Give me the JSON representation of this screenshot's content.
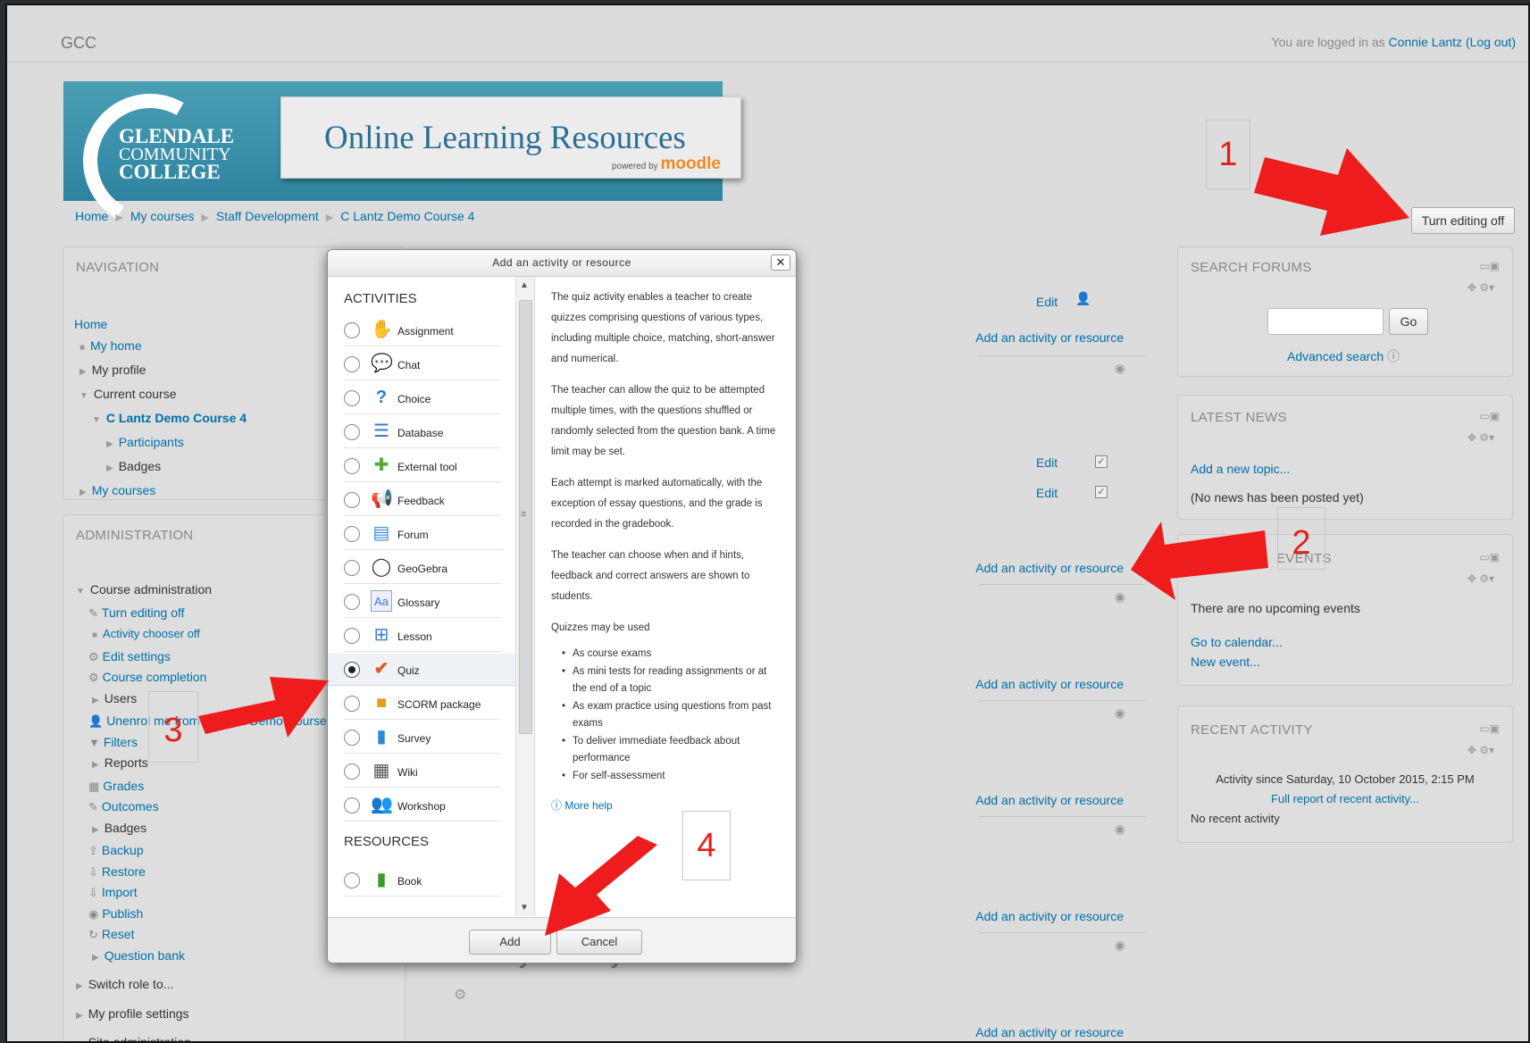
{
  "site_name": "GCC",
  "login": {
    "prefix": "You are logged in as ",
    "user": "Connie Lantz",
    "logout": "(Log out)"
  },
  "banner": {
    "college_line1": "GLENDALE",
    "college_line2": "COMMUNITY",
    "college_line3": "COLLEGE",
    "title": "Online Learning Resources",
    "powered_by": "powered by",
    "moodle": "moodle"
  },
  "breadcrumb": [
    "Home",
    "My courses",
    "Staff Development",
    "C Lantz Demo Course 4"
  ],
  "turn_editing_button": "Turn editing off",
  "navigation": {
    "title": "NAVIGATION",
    "items": [
      "Home",
      "My home",
      "My profile",
      "Current course",
      "C Lantz Demo Course 4",
      "Participants",
      "Badges",
      "My courses"
    ]
  },
  "administration": {
    "title": "ADMINISTRATION",
    "items": [
      "Course administration",
      "Turn editing off",
      "Activity chooser off",
      "Edit settings",
      "Course completion",
      "Users",
      "Unenrol me from C Lantz Demo Course 4",
      "Filters",
      "Reports",
      "Grades",
      "Outcomes",
      "Badges",
      "Backup",
      "Restore",
      "Import",
      "Publish",
      "Reset",
      "Question bank",
      "Switch role to...",
      "My profile settings",
      "Site administration"
    ]
  },
  "course": {
    "add_activity": "Add an activity or resource",
    "edit": "Edit",
    "section_heading_fragment": "6 July - 12 July"
  },
  "search_forums": {
    "title": "SEARCH FORUMS",
    "go": "Go",
    "advanced": "Advanced search"
  },
  "latest_news": {
    "title": "LATEST NEWS",
    "add_topic": "Add a new topic...",
    "none": "(No news has been posted yet)"
  },
  "upcoming_events": {
    "title": "UPCOMING EVENTS",
    "title_visible": "EVENTS",
    "none": "There are no upcoming events",
    "calendar": "Go to calendar...",
    "new_event": "New event..."
  },
  "recent_activity": {
    "title": "RECENT ACTIVITY",
    "since": "Activity since Saturday, 10 October 2015, 2:15 PM",
    "full_report": "Full report of recent activity...",
    "none": "No recent activity"
  },
  "modal": {
    "title": "Add an activity or resource",
    "activities_heading": "ACTIVITIES",
    "resources_heading": "RESOURCES",
    "activities": [
      "Assignment",
      "Chat",
      "Choice",
      "Database",
      "External tool",
      "Feedback",
      "Forum",
      "GeoGebra",
      "Glossary",
      "Lesson",
      "Quiz",
      "SCORM package",
      "Survey",
      "Wiki",
      "Workshop"
    ],
    "resources": [
      "Book"
    ],
    "selected": "Quiz",
    "help": {
      "p1": "The quiz activity enables a teacher to create quizzes comprising questions of various types, including multiple choice, matching, short-answer and numerical.",
      "p2": "The teacher can allow the quiz to be attempted multiple times, with the questions shuffled or randomly selected from the question bank. A time limit may be set.",
      "p3": "Each attempt is marked automatically, with the exception of essay questions, and the grade is recorded in the gradebook.",
      "p4": "The teacher can choose when and if hints, feedback and correct answers are shown to students.",
      "p5": "Quizzes may be used",
      "uses": [
        "As course exams",
        "As mini tests for reading assignments or at the end of a topic",
        "As exam practice using questions from past exams",
        "To deliver immediate feedback about performance",
        "For self-assessment"
      ],
      "more_help": "More help"
    },
    "add_button": "Add",
    "cancel_button": "Cancel"
  },
  "annotations": [
    "1",
    "2",
    "3",
    "4"
  ],
  "colors": {
    "arrow": "#ee1c1c",
    "link": "#0070a8",
    "annotation_text": "#e0241b"
  }
}
